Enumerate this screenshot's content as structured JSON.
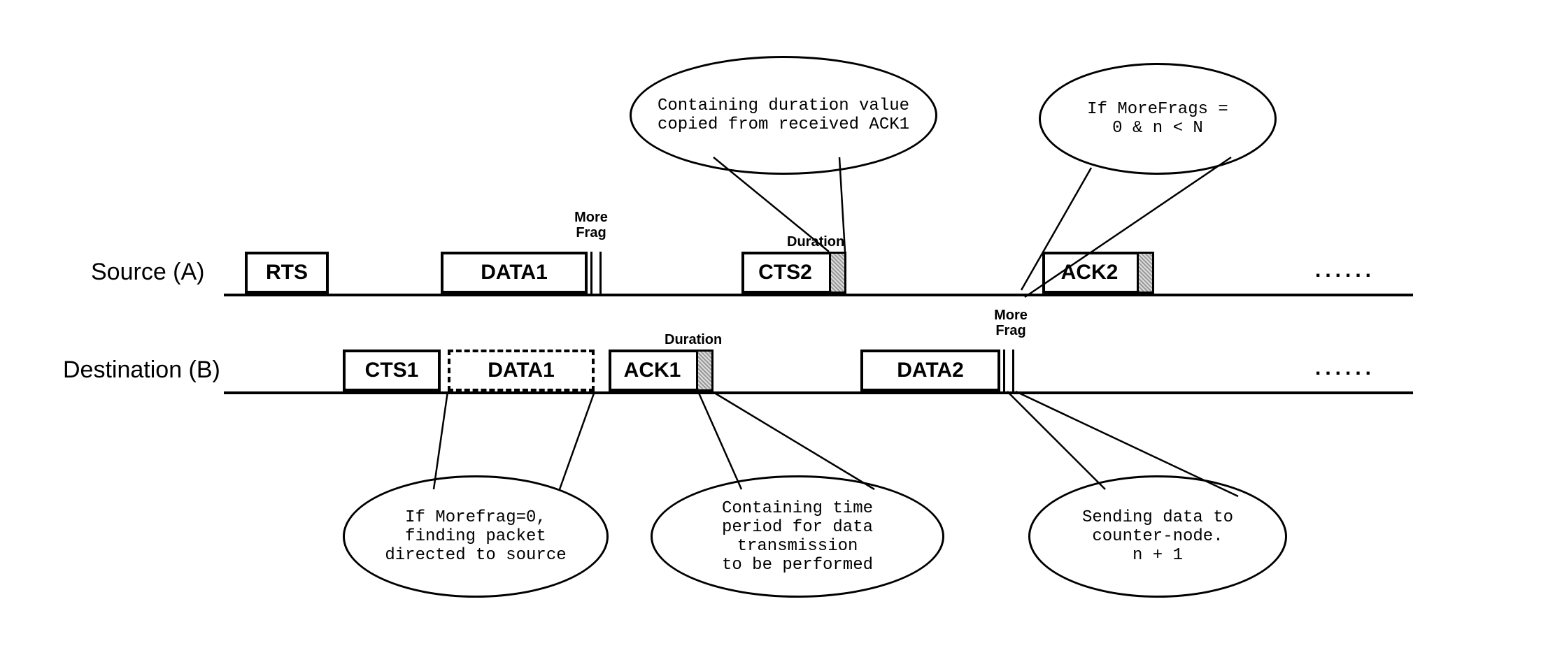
{
  "chart_data": {
    "type": "sequence-diagram",
    "actors": [
      {
        "id": "A",
        "label": "Source (A)"
      },
      {
        "id": "B",
        "label": "Destination (B)"
      }
    ],
    "sourceBoxes": [
      {
        "name": "RTS",
        "flags": []
      },
      {
        "name": "DATA1",
        "flags": [
          "MoreFrag"
        ]
      },
      {
        "name": "CTS2",
        "flags": [
          "Duration"
        ]
      },
      {
        "name": "ACK2",
        "flags": [
          "shaded"
        ]
      }
    ],
    "destBoxes": [
      {
        "name": "CTS1",
        "flags": []
      },
      {
        "name": "DATA1",
        "flags": [
          "dashed"
        ]
      },
      {
        "name": "ACK1",
        "flags": [
          "Duration"
        ]
      },
      {
        "name": "DATA2",
        "flags": [
          "MoreFrag"
        ]
      }
    ],
    "annotations": [
      {
        "target": "CTS2",
        "text": "Containing duration value copied from received ACK1"
      },
      {
        "target": "ACK2",
        "text": "If MoreFrags = 0 & n < N"
      },
      {
        "target": "DATA1(dest)",
        "text": "If Morefrag=0, finding packet directed to source"
      },
      {
        "target": "ACK1",
        "text": "Containing time period for data transmission to be performed"
      },
      {
        "target": "DATA2(send)",
        "text": "Sending data to counter-node. n + 1"
      }
    ],
    "fieldLabels": {
      "moreFrag": "More\nFrag",
      "duration": "Duration"
    },
    "continuation": "......"
  },
  "labels": {
    "sourceA": "Source (A)",
    "destB": "Destination (B)",
    "rts": "RTS",
    "data1": "DATA1",
    "cts2": "CTS2",
    "ack2": "ACK2",
    "cts1": "CTS1",
    "data1b": "DATA1",
    "ack1": "ACK1",
    "data2": "DATA2",
    "moreFrag": "More\nFrag",
    "duration": "Duration",
    "dots": "......",
    "bubbleCts2": "Containing duration value\ncopied from received ACK1",
    "bubbleAck2": "If MoreFrags =\n0 & n < N",
    "bubbleData1b": "If Morefrag=0,\nfinding packet\ndirected to source",
    "bubbleAck1": "Containing time\nperiod for data transmission\nto be performed",
    "bubbleData2": "Sending data to\ncounter-node.\nn + 1"
  }
}
